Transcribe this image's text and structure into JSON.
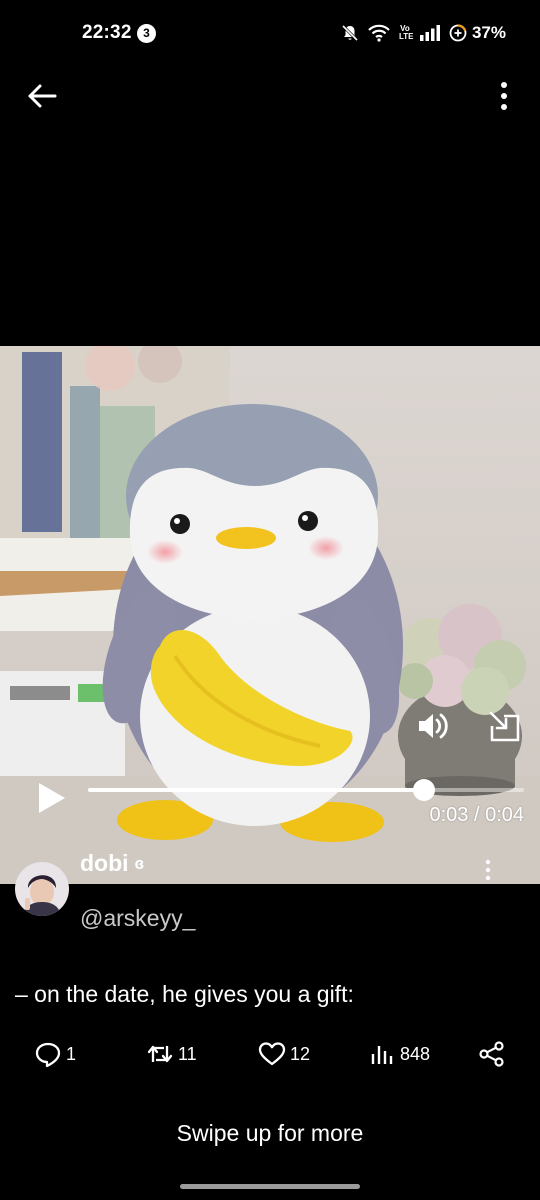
{
  "status_bar": {
    "time": "22:32",
    "notification_count": "3",
    "network_label_top": "Vo",
    "network_label_bottom": "LTE",
    "battery_percent": "37%",
    "icons": [
      "mute-bell-icon",
      "wifi-icon",
      "volte-icon",
      "signal-icon",
      "battery-saver-icon"
    ]
  },
  "top_bar": {
    "back_icon": "arrow-left-icon",
    "menu_icon": "more-vertical-icon"
  },
  "video": {
    "current_time": "0:03",
    "duration": "0:04",
    "time_display": "0:03 / 0:04",
    "progress_fraction": 0.77,
    "controls": [
      "play-icon",
      "volume-icon",
      "expand-icon"
    ]
  },
  "tweet": {
    "author_name": "dobi",
    "author_badge": "ɞ",
    "handle": "@arskeyy_",
    "text": "– on the date, he gives you a gift:",
    "menu_icon": "more-vertical-icon"
  },
  "actions": {
    "replies": "1",
    "reposts": "11",
    "likes": "12",
    "views": "848",
    "share_icon": "share-icon"
  },
  "footer": {
    "swipe_hint": "Swipe up for more"
  },
  "colors": {
    "background": "#000000",
    "text": "#ffffff",
    "handle": "#c9c9c9",
    "penguin_gray": "#8d8ca6",
    "banana_yellow": "#f2d32a"
  }
}
